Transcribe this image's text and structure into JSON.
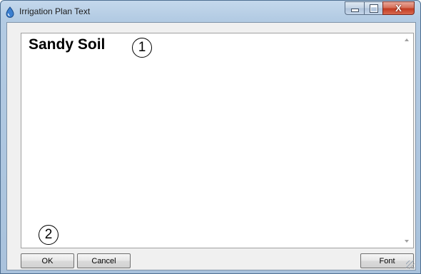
{
  "window": {
    "title": "Irrigation Plan Text",
    "controls": {
      "minimize": "minimize",
      "maximize": "maximize",
      "close": "X"
    }
  },
  "editor": {
    "text": "Sandy Soil"
  },
  "callouts": {
    "one": "1",
    "two": "2"
  },
  "buttons": {
    "ok": "OK",
    "cancel": "Cancel",
    "font": "Font"
  },
  "icons": {
    "app": "water-drop-icon",
    "scroll_up": "scroll-up-arrow-icon",
    "scroll_down": "scroll-down-arrow-icon",
    "resize": "resize-grip-icon"
  },
  "colors": {
    "titlebar": "#b3cbe3",
    "close_button": "#c23b22",
    "app_icon": "#3b7fd0"
  }
}
